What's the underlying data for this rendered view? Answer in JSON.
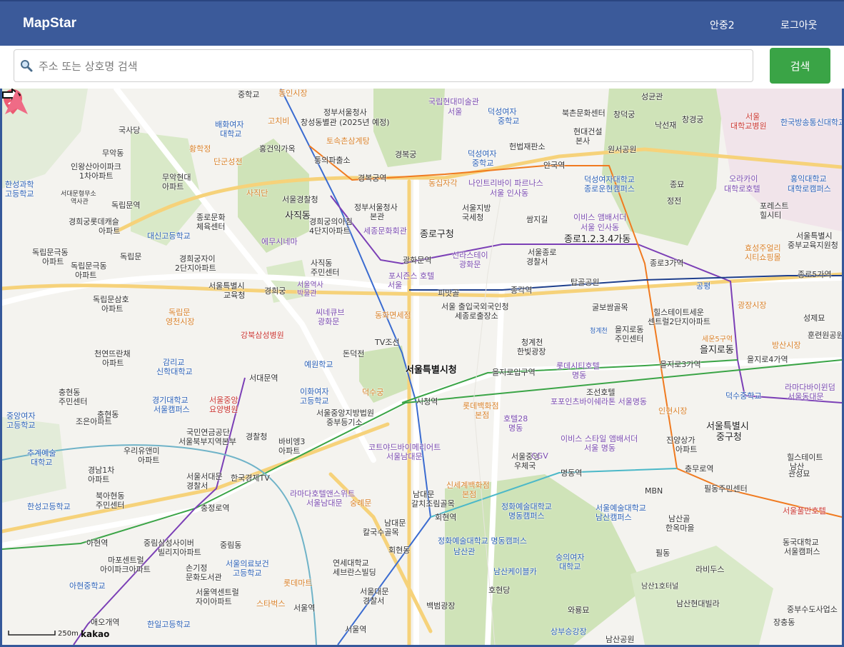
{
  "app": {
    "brand": "MapStar",
    "user": "안중2",
    "logout": "로그아웃"
  },
  "search": {
    "placeholder": "주소 또는 상호명 검색",
    "button": "검색"
  },
  "map": {
    "selected_place": "서울특별시청",
    "scale_label": "250m",
    "provider": "kakao",
    "labels": {
      "l1": "중학교",
      "l2": "통인시장",
      "l3": "정부서울청사",
      "l4": "창성동별관 (2025년 예정)",
      "l5": "국립현대미술관",
      "l6": "서울",
      "l7": "덕성여자",
      "l8": "중학교",
      "l9": "북촌문화센터",
      "l10": "창덕궁",
      "l11": "성균관",
      "l12": "낙선재",
      "l13": "창경궁",
      "l14": "서울",
      "l15": "대학교병원",
      "l16": "한국방송통신대학교",
      "l17": "국사당",
      "l18": "배화여자",
      "l19": "대학교",
      "l20": "고치비",
      "l21": "홍건익가옥",
      "l22": "토속촌삼계탕",
      "l23": "경복궁",
      "l24": "헌법재판소",
      "l25": "현대건설",
      "l26": "본사",
      "l27": "원서공원",
      "l28": "무악동",
      "l29": "황학정",
      "l30": "단군성전",
      "l31": "통의파출소",
      "l32": "덕성여자",
      "l33": "중학교",
      "l34": "안국역",
      "l35": "인왕산아이파크",
      "l36": "1차아파트",
      "l37": "무악현대",
      "l38": "아파트",
      "l39": "경복궁역",
      "l40": "동십자각",
      "l41": "나인트리바이 파르나스",
      "l42": "서울 인사동",
      "l43": "덕성여자대학교",
      "l44": "종로운현캠퍼스",
      "l45": "종묘",
      "l46": "오라카이",
      "l47": "대학로호텔",
      "l48": "홍익대학교",
      "l49": "대학로캠퍼스",
      "l50": "한성과학",
      "l51": "고등학교",
      "l52": "서대문형무소",
      "l53": "역사관",
      "l54": "독립문역",
      "l55": "사직단",
      "l56": "서울경찰청",
      "l57": "정부서울청사",
      "l58": "본관",
      "l59": "서울지방",
      "l60": "국세청",
      "l61": "쌈지길",
      "l62": "이비스 앰배서더",
      "l63": "서울 인사동",
      "l64": "정전",
      "l65": "포레스트",
      "l66": "힐시티",
      "l67": "경희궁롯데캐슬",
      "l68": "아파트",
      "l69": "종로문화",
      "l70": "체육센터",
      "l71": "사직동",
      "l72": "경희궁의아침",
      "l73": "4단지아파트",
      "l74": "세종문화회관",
      "l75": "종로구청",
      "l76": "종로1.2.3.4가동",
      "l77": "서울특별시",
      "l78": "중부교육지원청",
      "l79": "대신고등학교",
      "l80": "에무시네마",
      "l81": "신라스테이",
      "l82": "광화문",
      "l83": "서울종로",
      "l84": "경찰서",
      "l85": "효성주얼리",
      "l86": "시티쇼핑몰",
      "l87": "독립문극동",
      "l88": "아파트",
      "l89": "독립문",
      "l90": "경희궁자이",
      "l91": "2단지아파트",
      "l92": "사직동",
      "l93": "주민센터",
      "l94": "광화문역",
      "l95": "포시즌스 호텔",
      "l96": "서울",
      "l97": "종로3가역",
      "l98": "종로5가역",
      "l99": "독립문극동",
      "l100": "아파트",
      "l101": "서울특별시",
      "l102": "교육청",
      "l103": "경희궁",
      "l104": "서울역사",
      "l105": "박물관",
      "l106": "피맛골",
      "l107": "종각역",
      "l108": "탑골공원",
      "l109": "공평",
      "l110": "성제묘",
      "l111": "독립문삼호",
      "l112": "아파트",
      "l113": "독립문",
      "l114": "영천시장",
      "l115": "씨네큐브",
      "l116": "광화문",
      "l117": "동화면세점",
      "l118": "서울 출입국외국인청",
      "l119": "세종로출장소",
      "l120": "굴보쌈골목",
      "l121": "힐스테이트세운",
      "l122": "센트럴2단지아파트",
      "l123": "광장시장",
      "l124": "강북삼성병원",
      "l125": "TV조선",
      "l126": "청계천",
      "l127": "한빛광장",
      "l128": "을지로동",
      "l129": "주민센터",
      "l130": "세운5구역",
      "l131": "을지로동",
      "l132": "방산시장",
      "l133": "훈련원공원",
      "l134": "천연뜨란채",
      "l135": "아파트",
      "l136": "감리교",
      "l137": "신학대학교",
      "l138": "예원학교",
      "l139": "돈덕전",
      "l140": "롯데시티호텔",
      "l141": "명동",
      "l142": "을지로3가역",
      "l143": "을지로4가역",
      "l144": "라마다바이윈덤",
      "l145": "서울동대문",
      "l146": "충현동",
      "l147": "주민센터",
      "l148": "서대문역",
      "l149": "이화여자",
      "l150": "고등학교",
      "l151": "덕수궁",
      "l152": "을지로입구역",
      "l153": "조선호텔",
      "l154": "덕수중학교",
      "l155": "중앙여자",
      "l156": "고등학교",
      "l157": "경기대학교",
      "l158": "서울캠퍼스",
      "l159": "서울중앙",
      "l160": "요양병원",
      "l161": "서울중앙지방법원",
      "l162": "중부등기소",
      "l163": "시청역",
      "l164": "롯데백화점",
      "l165": "본점",
      "l166": "포포인츠바이쉐라톤 서울명동",
      "l167": "인현시장",
      "l168": "서울특별시",
      "l169": "중구청",
      "l170": "조은아파트",
      "l171": "충현동",
      "l172": "국민연금공단",
      "l173": "서울북부지역본부",
      "l174": "경찰청",
      "l175": "바비엥3",
      "l176": "아파트",
      "l177": "호텔28",
      "l178": "명동",
      "l179": "이비스 스타일 앰배서더",
      "l180": "서울 명동",
      "l181": "진양상가",
      "l182": "아파트",
      "l183": "추계예술",
      "l184": "대학교",
      "l185": "우리유앤미",
      "l186": "아파트",
      "l187": "코트야드바이메리어트",
      "l188": "서울남대문",
      "l189": "서울중앙",
      "l190": "우체국",
      "l191": "CGV",
      "l192": "힐스테이트",
      "l193": "남산",
      "l194": "경남1차",
      "l195": "아파트",
      "l196": "서울서대문",
      "l197": "경찰서",
      "l198": "한국경제TV",
      "l199": "명동역",
      "l200": "충무로역",
      "l201": "관성묘",
      "l202": "북아현동",
      "l203": "주민센터",
      "l204": "라마다호텔앤스위트",
      "l205": "서울남대문",
      "l206": "남대문",
      "l207": "갈치조림골목",
      "l208": "신세계백화점",
      "l209": "본점",
      "l210": "MBN",
      "l211": "필동주민센터",
      "l212": "서울풀만호텔",
      "l213": "한성고등학교",
      "l214": "충정로역",
      "l215": "숭례문",
      "l216": "회현역",
      "l217": "정화예술대학교",
      "l218": "명동캠퍼스",
      "l219": "서울예술대학교",
      "l220": "남산캠퍼스",
      "l221": "남산골",
      "l222": "한옥마을",
      "l223": "아현역",
      "l224": "중림삼성사이버",
      "l225": "빌리지아파트",
      "l226": "남대문",
      "l227": "칼국수골목",
      "l228": "회현동",
      "l229": "정화예술대학교 명동캠퍼스",
      "l230": "남산관",
      "l231": "필동",
      "l232": "동국대학교",
      "l233": "서울캠퍼스",
      "l234": "마포센트럴",
      "l235": "아이파크아파트",
      "l236": "중림동",
      "l237": "손기정",
      "l238": "문화도서관",
      "l239": "서울의료보건",
      "l240": "고등학교",
      "l241": "연세대학교",
      "l242": "세브란스빌딩",
      "l243": "남산케이블카",
      "l244": "숭의여자",
      "l245": "대학교",
      "l246": "라비두스",
      "l247": "아현중학교",
      "l248": "서울역센트럴",
      "l249": "자이아파트",
      "l250": "롯데마트",
      "l251": "서울대문",
      "l252": "경찰서",
      "l253": "호현당",
      "l254": "남산1호터널",
      "l255": "남산현대빌라",
      "l256": "애오개역",
      "l257": "스타벅스",
      "l258": "서울역",
      "l259": "백범광장",
      "l260": "와룡묘",
      "l261": "장충동",
      "l262": "한일고등학교",
      "l263": "서울역",
      "l264": "상부승강장",
      "l265": "남산공원",
      "l266": "중부수도사업소"
    }
  }
}
